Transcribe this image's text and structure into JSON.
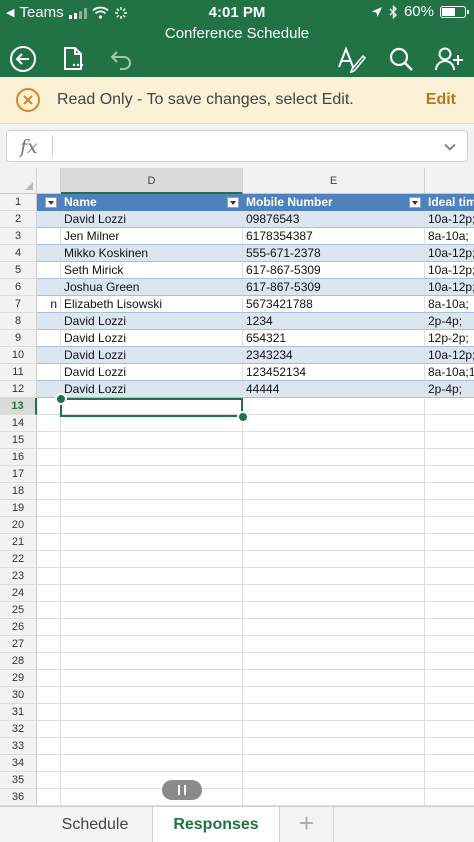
{
  "status_bar": {
    "carrier": "Teams",
    "time": "4:01 PM",
    "battery": "60%",
    "battery_level": 0.6
  },
  "header": {
    "title": "Conference Schedule",
    "icons": [
      "back-icon",
      "file-icon",
      "undo-icon",
      "draw-icon",
      "search-icon",
      "add-person-icon"
    ]
  },
  "readonly_bar": {
    "message": "Read Only - To save changes, select Edit.",
    "action": "Edit"
  },
  "formula_bar": {
    "label": "fx",
    "value": ""
  },
  "sheet": {
    "columns": [
      "D",
      "E"
    ],
    "selected_row": "13",
    "header_row": {
      "row": "1",
      "cells": [
        "Name",
        "Mobile Number",
        "Ideal tim"
      ]
    },
    "rows": [
      {
        "row": "2",
        "c": "",
        "d": "David Lozzi",
        "e": "09876543",
        "f": "10a-12p;"
      },
      {
        "row": "3",
        "c": "",
        "d": "Jen Milner",
        "e": "6178354387",
        "f": "8a-10a;"
      },
      {
        "row": "4",
        "c": "",
        "d": "Mikko Koskinen",
        "e": "555-671-2378",
        "f": "10a-12p;"
      },
      {
        "row": "5",
        "c": "",
        "d": "Seth Mirick",
        "e": "617-867-5309",
        "f": "10a-12p;"
      },
      {
        "row": "6",
        "c": "",
        "d": "Joshua Green",
        "e": "617-867-5309",
        "f": "10a-12p;"
      },
      {
        "row": "7",
        "c": "n",
        "d": "Elizabeth Lisowski",
        "e": "5673421788",
        "f": "8a-10a;"
      },
      {
        "row": "8",
        "c": "",
        "d": "David Lozzi",
        "e": "1234",
        "f": "2p-4p;"
      },
      {
        "row": "9",
        "c": "",
        "d": "David Lozzi",
        "e": "654321",
        "f": "12p-2p;"
      },
      {
        "row": "10",
        "c": "",
        "d": "David Lozzi",
        "e": "2343234",
        "f": "10a-12p;"
      },
      {
        "row": "11",
        "c": "",
        "d": "David Lozzi",
        "e": "123452134",
        "f": "8a-10a;1"
      },
      {
        "row": "12",
        "c": "",
        "d": "David Lozzi",
        "e": "44444",
        "f": "2p-4p;"
      }
    ],
    "empty_rows": [
      "13",
      "14",
      "15",
      "16",
      "17",
      "18",
      "19",
      "20",
      "21",
      "22",
      "23",
      "24",
      "25",
      "26",
      "27",
      "28",
      "29",
      "30",
      "31",
      "32",
      "33",
      "34",
      "35",
      "36"
    ]
  },
  "tabs": {
    "items": [
      "Schedule",
      "Responses"
    ],
    "active": "Responses",
    "add_label": "+"
  },
  "colors": {
    "accent": "#217346",
    "table_header": "#4f81bd",
    "table_band": "#dce6f1",
    "readonly_bg": "#fbf1d6",
    "edit_action": "#b07a1a"
  }
}
